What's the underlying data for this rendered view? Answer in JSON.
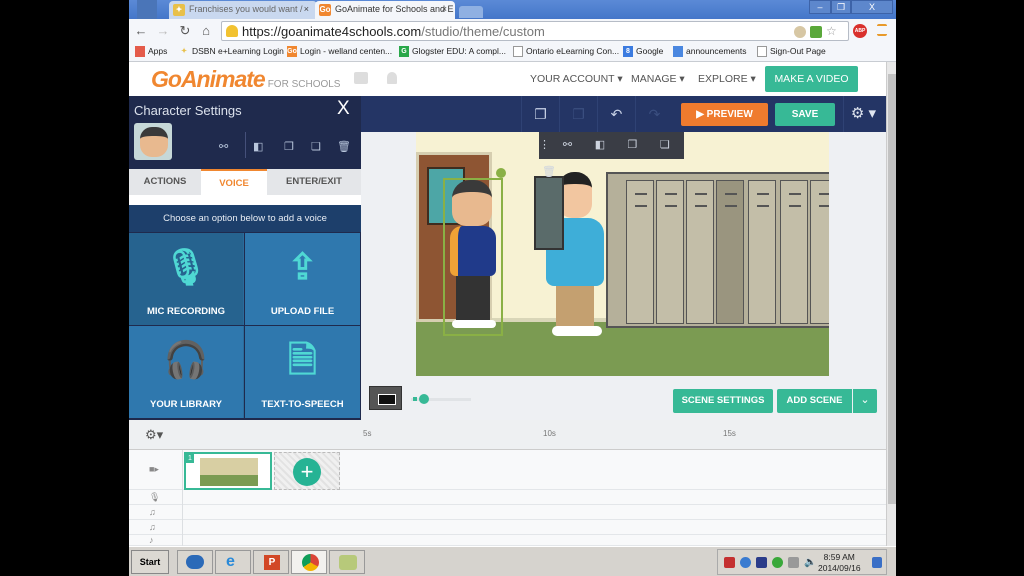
{
  "browser": {
    "tabs": [
      {
        "title": "Franchises you would want /",
        "favicon": "star-icon",
        "active": false
      },
      {
        "title": "GoAnimate for Schools and E",
        "favicon": "go-icon",
        "active": true
      }
    ],
    "window_controls": {
      "minimize": "–",
      "restore": "❐",
      "close": "X"
    },
    "url": {
      "host": "https://goanimate4schools.com",
      "path": "/studio/theme/custom"
    },
    "bookmarks": [
      {
        "label": "Apps",
        "icon": "apps-icon"
      },
      {
        "label": "DSBN e+Learning Login",
        "icon": "star-icon"
      },
      {
        "label": "Login - welland centen...",
        "icon": "go-icon"
      },
      {
        "label": "Glogster EDU: A compl...",
        "icon": "g-icon"
      },
      {
        "label": "Ontario eLearning Con...",
        "icon": "page-icon"
      },
      {
        "label": "Google",
        "icon": "google-icon"
      },
      {
        "label": "announcements",
        "icon": "chat-icon"
      },
      {
        "label": "Sign-Out Page",
        "icon": "page-icon"
      }
    ],
    "extensions": {
      "abp": "ABP"
    }
  },
  "header": {
    "logo": "GoAnimate",
    "logo_sub": "FOR SCHOOLS",
    "nav": [
      "YOUR ACCOUNT ▾",
      "MANAGE ▾",
      "EXPLORE ▾"
    ],
    "cta": "MAKE A VIDEO"
  },
  "studio": {
    "preview": "▶ PREVIEW",
    "save": "SAVE",
    "settings_icon": "⚙ ▾"
  },
  "character_panel": {
    "title": "Character Settings",
    "close": "X",
    "tabs": [
      {
        "label": "ACTIONS",
        "active": false
      },
      {
        "label": "VOICE",
        "active": true
      },
      {
        "label": "ENTER/EXIT",
        "active": false
      }
    ],
    "message": "Choose an option below to add a voice",
    "options": [
      {
        "label": "MIC RECORDING",
        "icon": "microphone-icon"
      },
      {
        "label": "UPLOAD FILE",
        "icon": "upload-laptop-icon"
      },
      {
        "label": "YOUR LIBRARY",
        "icon": "headphones-user-icon"
      },
      {
        "label": "TEXT-TO-SPEECH",
        "icon": "document-speaker-icon"
      }
    ]
  },
  "stage_controls": {
    "scene_settings": "SCENE SETTINGS",
    "add_scene": "ADD SCENE",
    "add_scene_dropdown": "⌄"
  },
  "timeline": {
    "ticks": [
      "5s",
      "10s",
      "15s"
    ],
    "scenes": [
      {
        "number": "1"
      }
    ],
    "add": "+",
    "tracks": [
      "camera-icon",
      "microphone-icon",
      "music-icon",
      "music-icon",
      "music-icon"
    ]
  },
  "taskbar": {
    "start": "Start",
    "time": "8:59 AM",
    "date": "2014/09/16"
  }
}
